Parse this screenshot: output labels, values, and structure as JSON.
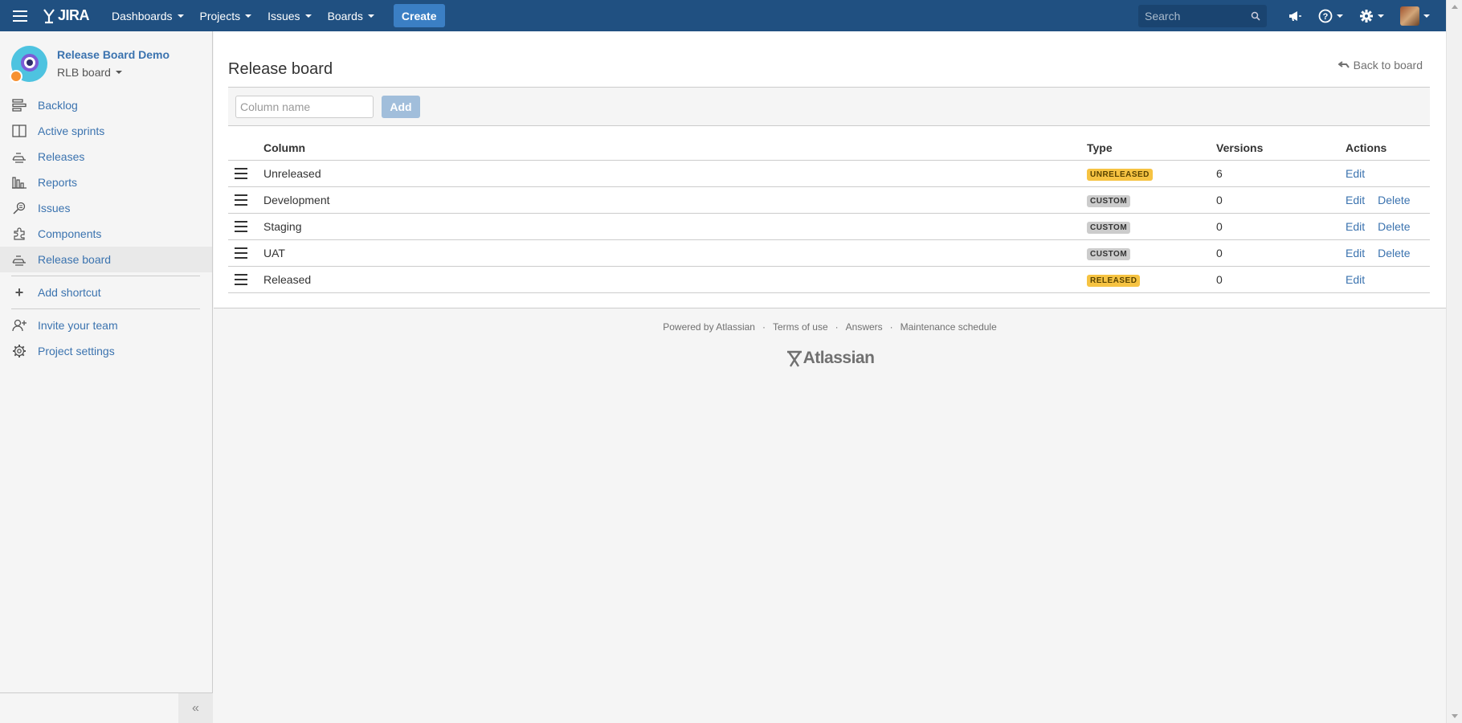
{
  "topnav": {
    "logo_text": "JIRA",
    "menu": [
      {
        "label": "Dashboards"
      },
      {
        "label": "Projects"
      },
      {
        "label": "Issues"
      },
      {
        "label": "Boards"
      }
    ],
    "create_label": "Create",
    "search_placeholder": "Search",
    "icons": [
      "menu-icon",
      "megaphone-icon",
      "help-icon",
      "gear-icon",
      "avatar"
    ],
    "brand_color": "#205081"
  },
  "sidebar": {
    "project_name": "Release Board Demo",
    "board_name": "RLB board",
    "items": [
      {
        "label": "Backlog",
        "icon": "backlog-icon"
      },
      {
        "label": "Active sprints",
        "icon": "active-sprints-icon"
      },
      {
        "label": "Releases",
        "icon": "releases-icon"
      },
      {
        "label": "Reports",
        "icon": "reports-icon"
      },
      {
        "label": "Issues",
        "icon": "issues-icon"
      },
      {
        "label": "Components",
        "icon": "components-icon"
      },
      {
        "label": "Release board",
        "icon": "release-board-icon",
        "active": true
      }
    ],
    "shortcut_label": "Add shortcut",
    "invite_label": "Invite your team",
    "settings_label": "Project settings",
    "collapse_glyph": "«"
  },
  "main": {
    "title": "Release board",
    "back_label": "Back to board",
    "column_input_placeholder": "Column name",
    "add_label": "Add",
    "table": {
      "headers": {
        "column": "Column",
        "type": "Type",
        "versions": "Versions",
        "actions": "Actions"
      },
      "rows": [
        {
          "column": "Unreleased",
          "type": "UNRELEASED",
          "type_color": "#f6c342",
          "versions": "6",
          "edit": "Edit",
          "delete": ""
        },
        {
          "column": "Development",
          "type": "CUSTOM",
          "type_color": "#cccccc",
          "versions": "0",
          "edit": "Edit",
          "delete": "Delete"
        },
        {
          "column": "Staging",
          "type": "CUSTOM",
          "type_color": "#cccccc",
          "versions": "0",
          "edit": "Edit",
          "delete": "Delete"
        },
        {
          "column": "UAT",
          "type": "CUSTOM",
          "type_color": "#cccccc",
          "versions": "0",
          "edit": "Edit",
          "delete": "Delete"
        },
        {
          "column": "Released",
          "type": "RELEASED",
          "type_color": "#f6c342",
          "versions": "0",
          "edit": "Edit",
          "delete": ""
        }
      ]
    }
  },
  "footer": {
    "links": [
      "Powered by Atlassian",
      "Terms of use",
      "Answers",
      "Maintenance schedule"
    ],
    "separator": "·",
    "logo_text": "Atlassian"
  }
}
